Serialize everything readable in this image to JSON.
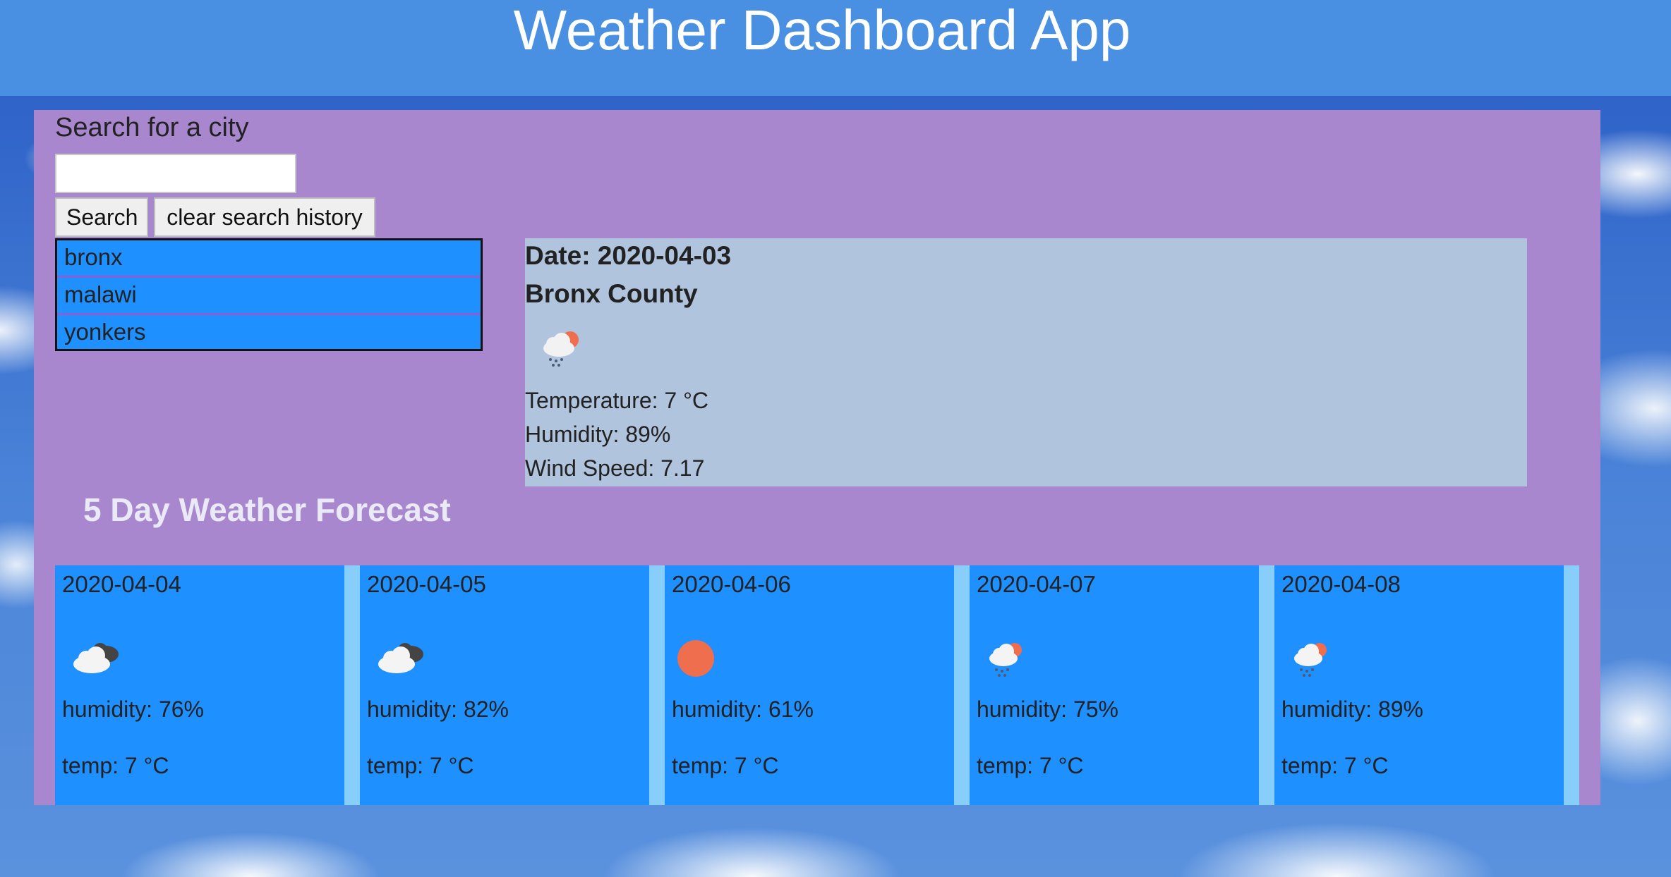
{
  "header": {
    "title": "Weather Dashboard App"
  },
  "search": {
    "label": "Search for a city",
    "input_value": "",
    "search_button": "Search",
    "clear_button": "clear search history",
    "history": [
      "bronx",
      "malawi",
      "yonkers"
    ]
  },
  "current": {
    "date": "Date: 2020-04-03",
    "city": "Bronx County",
    "icon": "light-rain-sun-icon",
    "temperature": "Temperature: 7 °C",
    "humidity": "Humidity: 89%",
    "wind": "Wind Speed: 7.17"
  },
  "forecast": {
    "title": "5 Day Weather Forecast",
    "days": [
      {
        "date": "2020-04-04",
        "icon": "cloudy-icon",
        "humidity": "humidity: 76%",
        "temp": "temp: 7 °C"
      },
      {
        "date": "2020-04-05",
        "icon": "cloudy-icon",
        "humidity": "humidity: 82%",
        "temp": "temp: 7 °C"
      },
      {
        "date": "2020-04-06",
        "icon": "sun-icon",
        "humidity": "humidity: 61%",
        "temp": "temp: 7 °C"
      },
      {
        "date": "2020-04-07",
        "icon": "light-rain-sun-icon",
        "humidity": "humidity: 75%",
        "temp": "temp: 7 °C"
      },
      {
        "date": "2020-04-08",
        "icon": "light-rain-sun-icon",
        "humidity": "humidity: 89%",
        "temp": "temp: 7 °C"
      }
    ]
  },
  "colors": {
    "header_bg": "#4a90e2",
    "panel_bg": "#a887ce",
    "history_bg": "#1e90ff",
    "current_bg": "#b0c4de",
    "card_bg": "#1e90ff"
  }
}
